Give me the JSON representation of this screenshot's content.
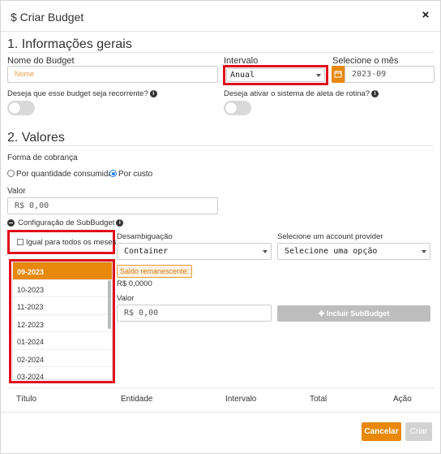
{
  "header": {
    "title": "$ Criar Budget",
    "close": "×"
  },
  "section1": {
    "title": "1. Informações gerais",
    "budget_name_label": "Nome do Budget",
    "budget_name_placeholder": "Nome",
    "interval_label": "Intervalo",
    "interval_value": "Anual",
    "month_label": "Selecione o mês",
    "month_value": "2023-09",
    "recurrent_label": "Deseja que esse budget seja recorrente?",
    "routine_alert_label": "Deseja ativar o sistema de aleta de rotina?"
  },
  "section2": {
    "title": "2. Valores",
    "billing_label": "Forma de cobrança",
    "billing_options": [
      "Por quantidade consumida",
      "Por custo"
    ],
    "billing_selected": "Por custo",
    "value_label": "Valor",
    "value": "R$ 0,00"
  },
  "subbudget": {
    "toggle_label": "Configuração de SubBudget",
    "same_for_all_label": "Igual para todos os meses",
    "months": [
      "09-2023",
      "10-2023",
      "11-2023",
      "12-2023",
      "01-2024",
      "02-2024",
      "03-2024"
    ],
    "selected_month": "09-2023",
    "disambiguation_label": "Desambiguação",
    "disambiguation_value": "Container",
    "account_provider_label": "Selecione um account provider",
    "account_provider_value": "Selecione uma opção",
    "remaining_label": "Saldo remanescente:",
    "remaining_value": "R$ 0,0000",
    "value_label": "Valor",
    "value": "R$ 0,00",
    "add_button": "Incluir SubBudget"
  },
  "table": {
    "columns": [
      "Título",
      "Entidade",
      "Intervalo",
      "Total",
      "Ação"
    ]
  },
  "footer": {
    "cancel": "Cancelar",
    "create": "Criar"
  },
  "colors": {
    "accent": "#e8880d",
    "highlight": "#e0101a",
    "radio": "#2a7de1"
  }
}
